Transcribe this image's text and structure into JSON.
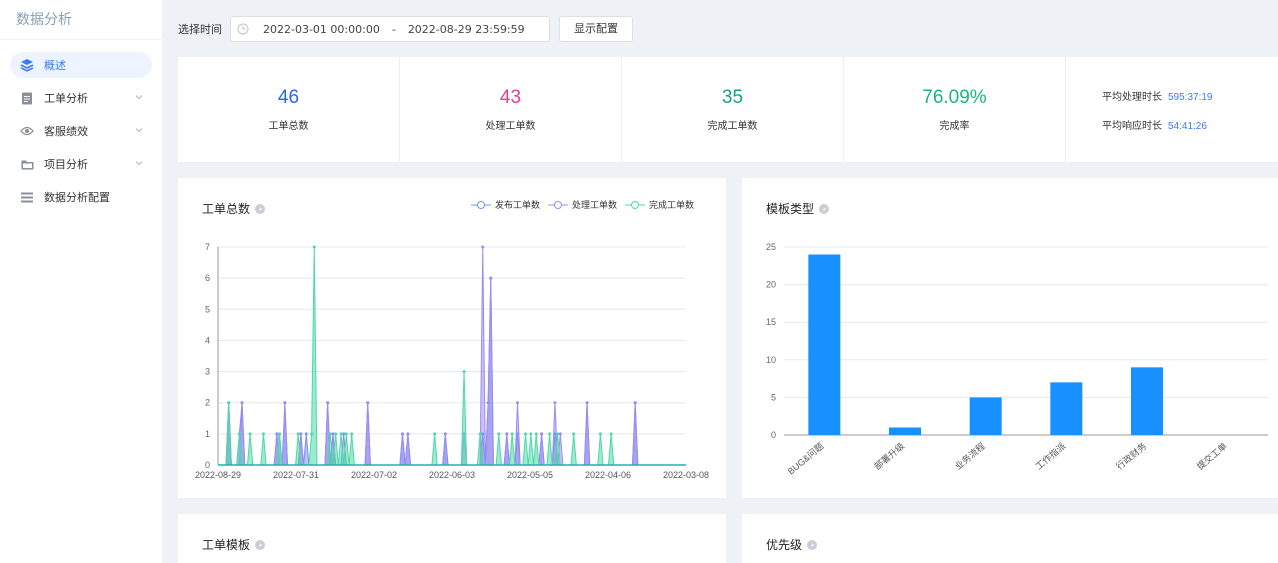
{
  "sidebar": {
    "title": "数据分析",
    "items": [
      {
        "label": "概述",
        "icon": "layers-icon",
        "active": true
      },
      {
        "label": "工单分析",
        "icon": "document-icon",
        "has_children": true
      },
      {
        "label": "客服绩效",
        "icon": "eye-icon",
        "has_children": true
      },
      {
        "label": "项目分析",
        "icon": "folder-icon",
        "has_children": true
      },
      {
        "label": "数据分析配置",
        "icon": "list-icon"
      }
    ]
  },
  "topbar": {
    "label": "选择时间",
    "start": "2022-03-01 00:00:00",
    "separator": "-",
    "end": "2022-08-29 23:59:59",
    "config_button": "显示配置"
  },
  "stats": [
    {
      "value": "46",
      "label": "工单总数",
      "color": "#2f64e8"
    },
    {
      "value": "43",
      "label": "处理工单数",
      "color": "#e83c9c"
    },
    {
      "value": "35",
      "label": "完成工单数",
      "color": "#16a085"
    },
    {
      "value": "76.09%",
      "label": "完成率",
      "color": "#18b67e"
    }
  ],
  "stat_times": [
    {
      "label": "平均处理时长",
      "value": "595:37:19"
    },
    {
      "label": "平均响应时长",
      "value": "54:41:26"
    }
  ],
  "colors": {
    "publish": "#7b8ff0",
    "process": "#9b8cf2",
    "complete": "#4dd9a6",
    "bar": "#1890ff",
    "accent": "#3a7bf2"
  },
  "cards": {
    "line": {
      "title": "工单总数"
    },
    "bar": {
      "title": "模板类型"
    },
    "template": {
      "title": "工单模板"
    },
    "priority": {
      "title": "优先级"
    }
  },
  "chart_data": [
    {
      "type": "line",
      "title": "工单总数",
      "legend_position": "top-right",
      "ylim": [
        0,
        7
      ],
      "yticks": [
        "0",
        "1",
        "2",
        "3",
        "4",
        "5",
        "6",
        "7"
      ],
      "xticks": [
        "2022-08-29",
        "2022-07-31",
        "2022-07-02",
        "2022-06-03",
        "2022-05-05",
        "2022-04-06",
        "2022-03-08"
      ],
      "x_days": 175,
      "series": [
        {
          "name": "发布工单数",
          "color": "#7b8ff0",
          "points": [
            [
              4,
              2
            ],
            [
              8,
              1
            ],
            [
              9,
              2
            ],
            [
              22,
              1
            ],
            [
              23,
              1
            ],
            [
              25,
              2
            ],
            [
              31,
              1
            ],
            [
              33,
              1
            ],
            [
              41,
              2
            ],
            [
              43,
              1
            ],
            [
              47,
              1
            ],
            [
              56,
              2
            ],
            [
              69,
              1
            ],
            [
              71,
              1
            ],
            [
              85,
              1
            ],
            [
              99,
              1
            ],
            [
              101,
              2
            ],
            [
              102,
              6
            ],
            [
              108,
              1
            ],
            [
              112,
              1
            ],
            [
              121,
              1
            ],
            [
              126,
              1
            ],
            [
              138,
              2
            ],
            [
              156,
              2
            ]
          ]
        },
        {
          "name": "处理工单数",
          "color": "#9b8cf2",
          "points": [
            [
              4,
              2
            ],
            [
              9,
              2
            ],
            [
              22,
              1
            ],
            [
              25,
              2
            ],
            [
              31,
              1
            ],
            [
              41,
              2
            ],
            [
              43,
              1
            ],
            [
              56,
              2
            ],
            [
              69,
              1
            ],
            [
              71,
              1
            ],
            [
              85,
              1
            ],
            [
              92,
              1
            ],
            [
              99,
              7
            ],
            [
              101,
              2
            ],
            [
              102,
              6
            ],
            [
              108,
              1
            ],
            [
              112,
              2
            ],
            [
              121,
              1
            ],
            [
              126,
              2
            ],
            [
              128,
              1
            ],
            [
              138,
              2
            ],
            [
              156,
              2
            ]
          ]
        },
        {
          "name": "完成工单数",
          "color": "#4dd9a6",
          "points": [
            [
              4,
              2
            ],
            [
              8,
              1
            ],
            [
              12,
              1
            ],
            [
              17,
              1
            ],
            [
              23,
              1
            ],
            [
              30,
              1
            ],
            [
              35,
              1
            ],
            [
              36,
              7
            ],
            [
              42,
              1
            ],
            [
              44,
              1
            ],
            [
              46,
              1
            ],
            [
              48,
              1
            ],
            [
              50,
              1
            ],
            [
              81,
              1
            ],
            [
              92,
              3
            ],
            [
              98,
              1
            ],
            [
              105,
              1
            ],
            [
              110,
              1
            ],
            [
              115,
              1
            ],
            [
              117,
              1
            ],
            [
              119,
              1
            ],
            [
              124,
              1
            ],
            [
              127,
              1
            ],
            [
              133,
              1
            ],
            [
              143,
              1
            ],
            [
              147,
              1
            ]
          ]
        }
      ]
    },
    {
      "type": "bar",
      "title": "模板类型",
      "categories": [
        "BUG&问题",
        "部署升级",
        "业务流程",
        "工作指派",
        "行政财务",
        "提交工单"
      ],
      "values": [
        24,
        1,
        5,
        7,
        9,
        0
      ],
      "ylim": [
        0,
        25
      ],
      "yticks": [
        "0",
        "5",
        "10",
        "15",
        "20",
        "25"
      ]
    }
  ]
}
